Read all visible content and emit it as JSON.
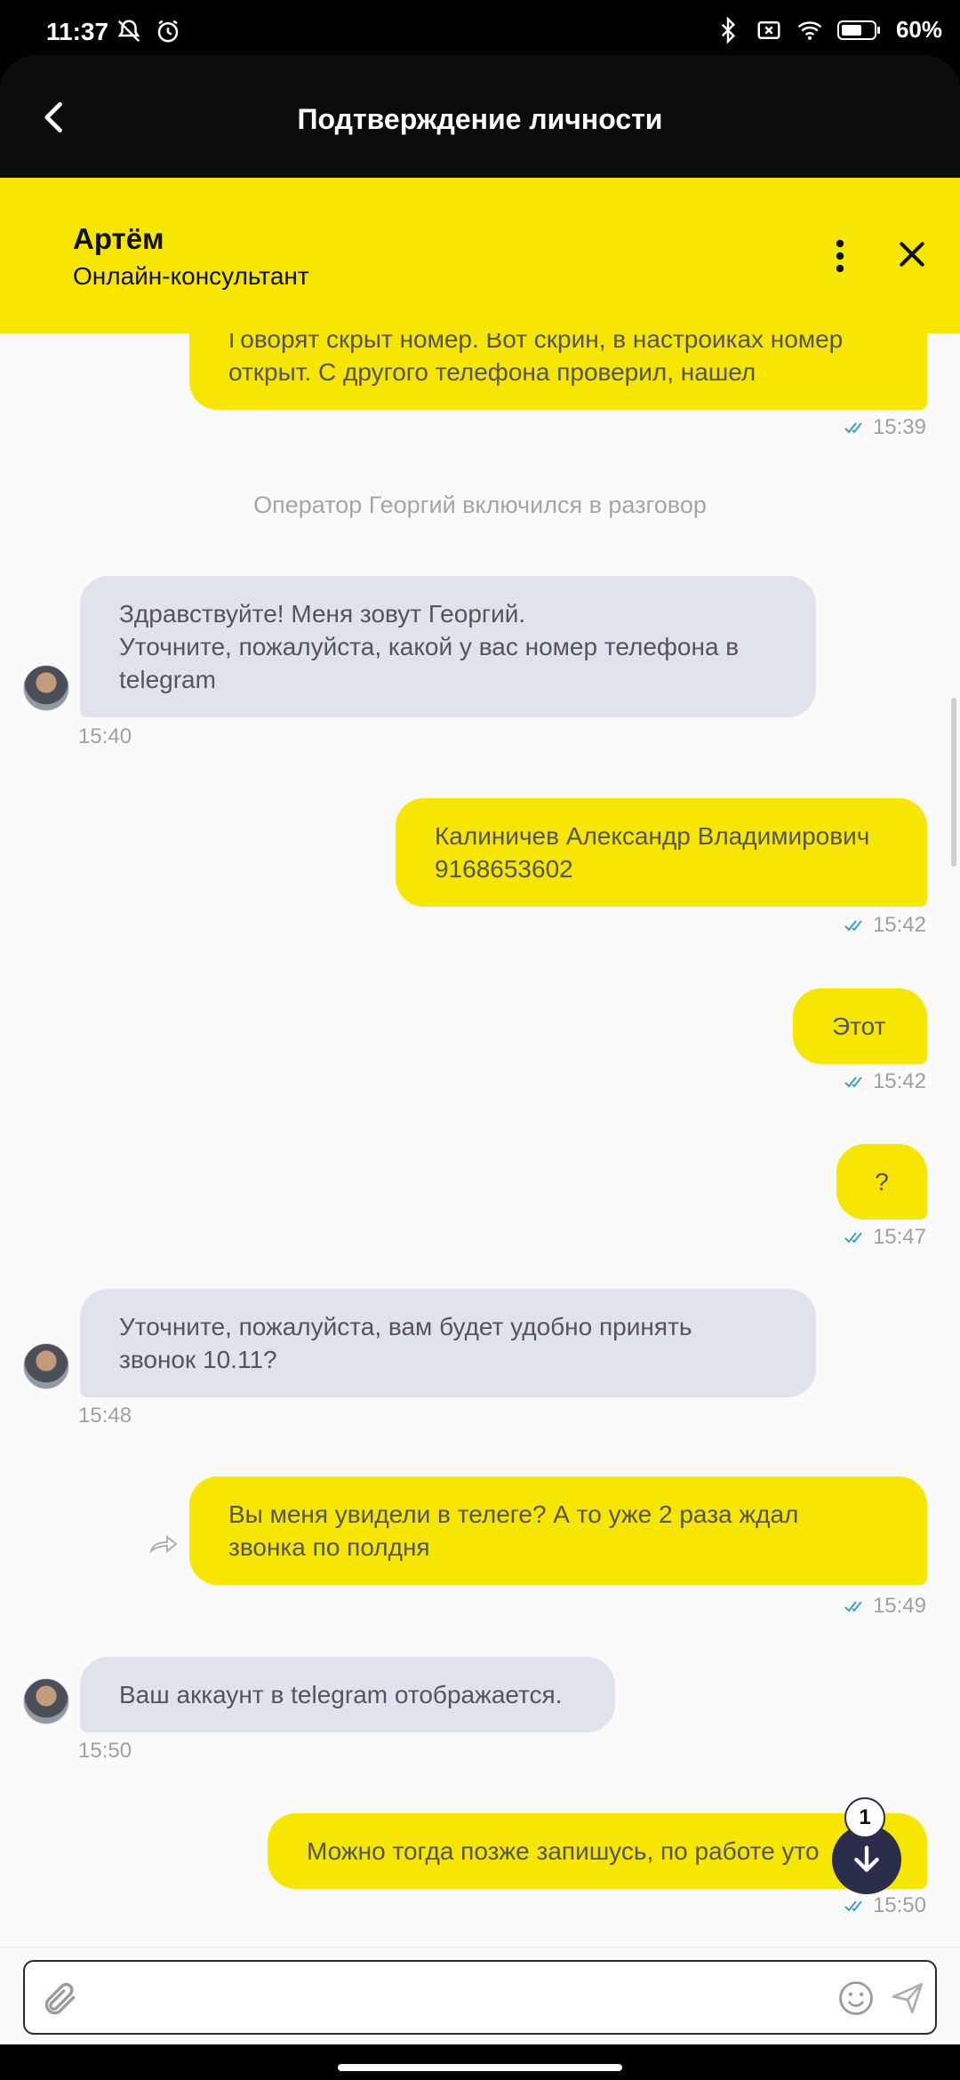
{
  "status_bar": {
    "time": "11:37",
    "battery": "60%"
  },
  "header": {
    "title": "Подтверждение личности"
  },
  "operator": {
    "name": "Артём",
    "role": "Онлайн-консультант"
  },
  "messages": [
    {
      "type": "user",
      "text": "Говорят скрыт номер. Вот скрин, в настройках номер\nоткрыт. С другого телефона проверил, нашел",
      "time": "15:39"
    },
    {
      "type": "system",
      "text": "Оператор Георгий включился в разговор"
    },
    {
      "type": "operator",
      "text": "Здравствуйте! Меня зовут Георгий.\nУточните, пожалуйста, какой у вас номер телефона в\ntelegram",
      "time": "15:40"
    },
    {
      "type": "user",
      "text": "Калиничев Александр Владимирович\n9168653602",
      "time": "15:42"
    },
    {
      "type": "user",
      "text": "Этот",
      "time": "15:42"
    },
    {
      "type": "user",
      "text": "?",
      "time": "15:47"
    },
    {
      "type": "operator",
      "text": "Уточните, пожалуйста, вам будет удобно принять\nзвонок 10.11?",
      "time": "15:48"
    },
    {
      "type": "user",
      "text": "Вы меня увидели в телеге? А то уже 2 раза ждал\nзвонка по полдня",
      "time": "15:49"
    },
    {
      "type": "operator",
      "text": "Ваш аккаунт в telegram отображается.",
      "time": "15:50"
    },
    {
      "type": "user",
      "text": "Можно тогда позже запишусь, по работе уто",
      "time": "15:50"
    }
  ],
  "scroll_badge": "1",
  "input": {
    "placeholder": ""
  },
  "colors": {
    "accent_yellow": "#f7e600",
    "operator_bubble": "#e0e2ee",
    "fab": "#2a2d4c"
  }
}
